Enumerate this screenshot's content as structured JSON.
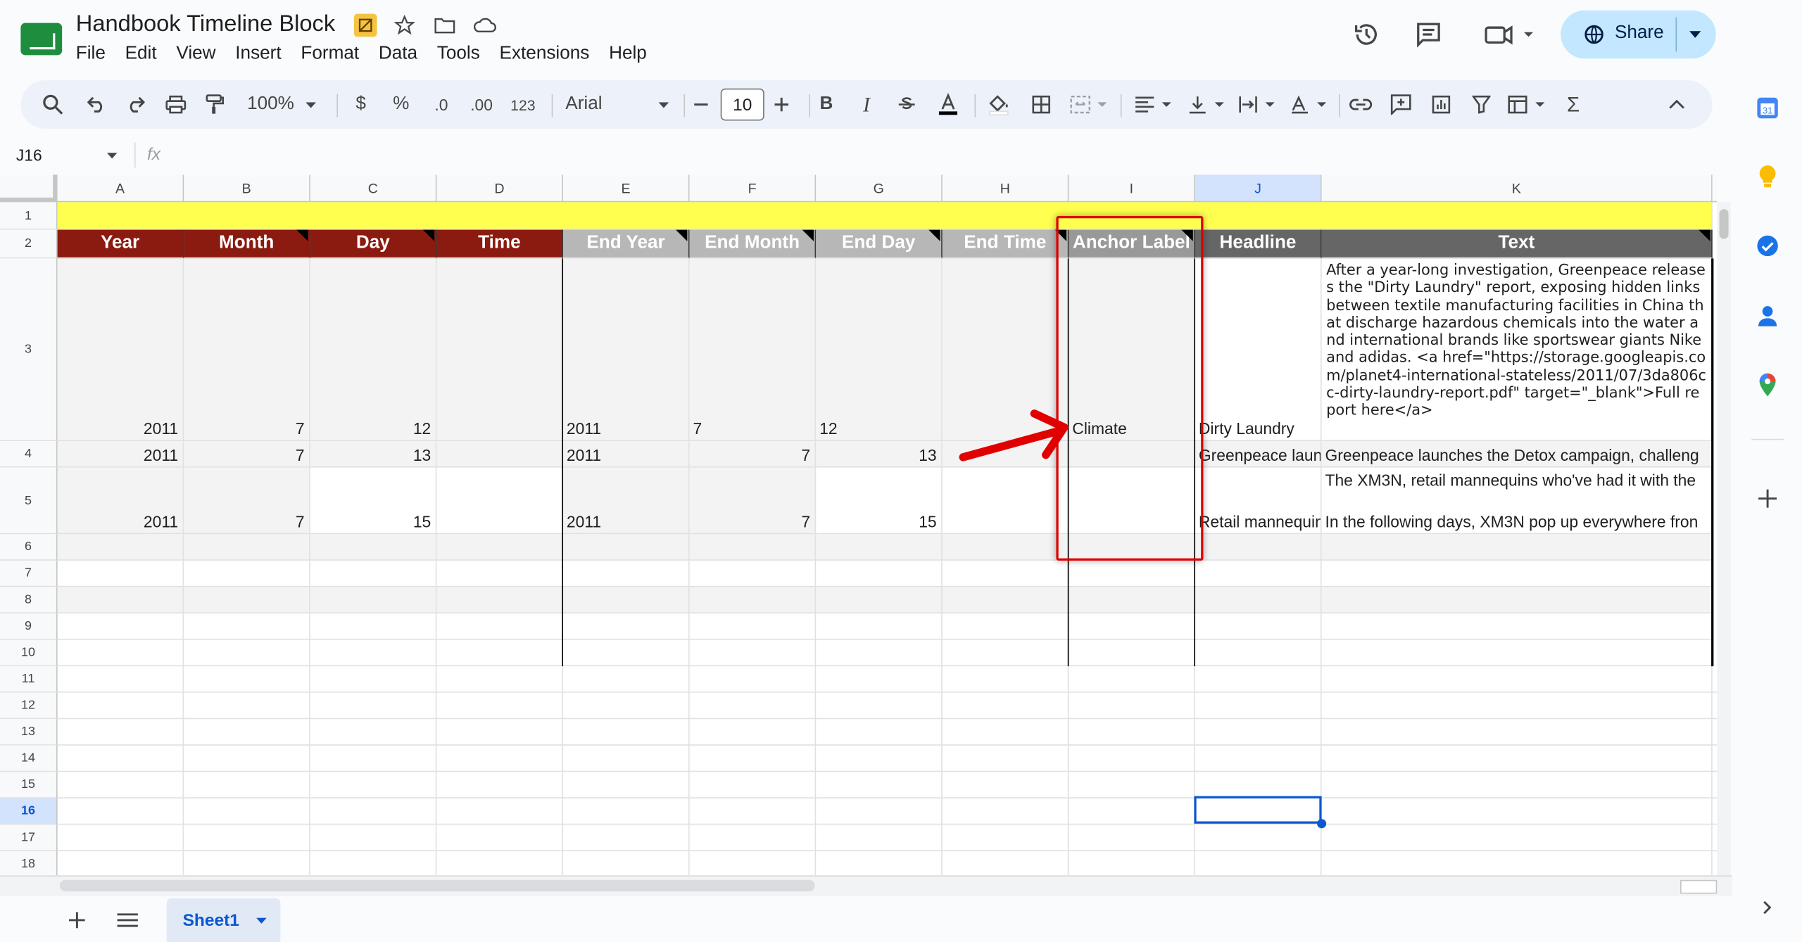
{
  "doc": {
    "title": "Handbook Timeline Block"
  },
  "menu": [
    "File",
    "Edit",
    "View",
    "Insert",
    "Format",
    "Data",
    "Tools",
    "Extensions",
    "Help"
  ],
  "share_label": "Share",
  "toolbar": {
    "zoom": "100%",
    "currency": "$",
    "percent": "%",
    "dec_dec": ".0",
    "inc_dec": ".00",
    "num_format": "123",
    "font": "Arial",
    "font_size": "10",
    "bold": "B",
    "italic": "I",
    "sum": "Σ"
  },
  "namebox": "J16",
  "fx": "fx",
  "columns": [
    "A",
    "B",
    "C",
    "D",
    "E",
    "F",
    "G",
    "H",
    "I",
    "J",
    "K"
  ],
  "rows": [
    "1",
    "2",
    "3",
    "4",
    "5",
    "6",
    "7",
    "8",
    "9",
    "10",
    "11",
    "12",
    "13",
    "14",
    "15",
    "16",
    "17",
    "18"
  ],
  "headers": [
    "Year",
    "Month",
    "Day",
    "Time",
    "End Year",
    "End Month",
    "End Day",
    "End Time",
    "Anchor Label",
    "Headline",
    "Text"
  ],
  "data_rows": [
    {
      "year": "2011",
      "month": "7",
      "day": "12",
      "end_year": "2011",
      "end_month": "7",
      "end_day": "12",
      "anchor": "Climate",
      "headline": "Dirty Laundry",
      "text": "After a year-long investigation, Greenpeace releases the \"Dirty Laundry\" report, exposing hidden links between textile manufacturing facilities in China that discharge hazardous chemicals into the water and international brands like sportswear giants Nike and adidas. <a href=\"https://storage.googleapis.com/planet4-international-stateless/2011/07/3da806cc-dirty-laundry-report.pdf\" target=\"_blank\">Full report here</a>"
    },
    {
      "year": "2011",
      "month": "7",
      "day": "13",
      "end_year": "2011",
      "end_month": "7",
      "end_day": "13",
      "anchor": "",
      "headline": "Greenpeace launches the Detox campaign",
      "text": "Greenpeace launches the Detox campaign, challeng"
    },
    {
      "year": "2011",
      "month": "7",
      "day": "15",
      "end_year": "2011",
      "end_month": "7",
      "end_day": "15",
      "anchor": "",
      "headline": "Retail mannequins",
      "text_top": "The XM3N, retail mannequins who've had it with the",
      "text": "In the following days, XM3N pop up everywhere fron"
    }
  ],
  "sheet_tab": "Sheet1",
  "colors": {
    "header_red": "#8b1a10",
    "header_gray": "#b7b7b7",
    "header_dark": "#666666",
    "yellow": "#ffff4f",
    "accent": "#0b57d0",
    "share_bg": "#c2e7ff",
    "annotation": "#e00000"
  }
}
